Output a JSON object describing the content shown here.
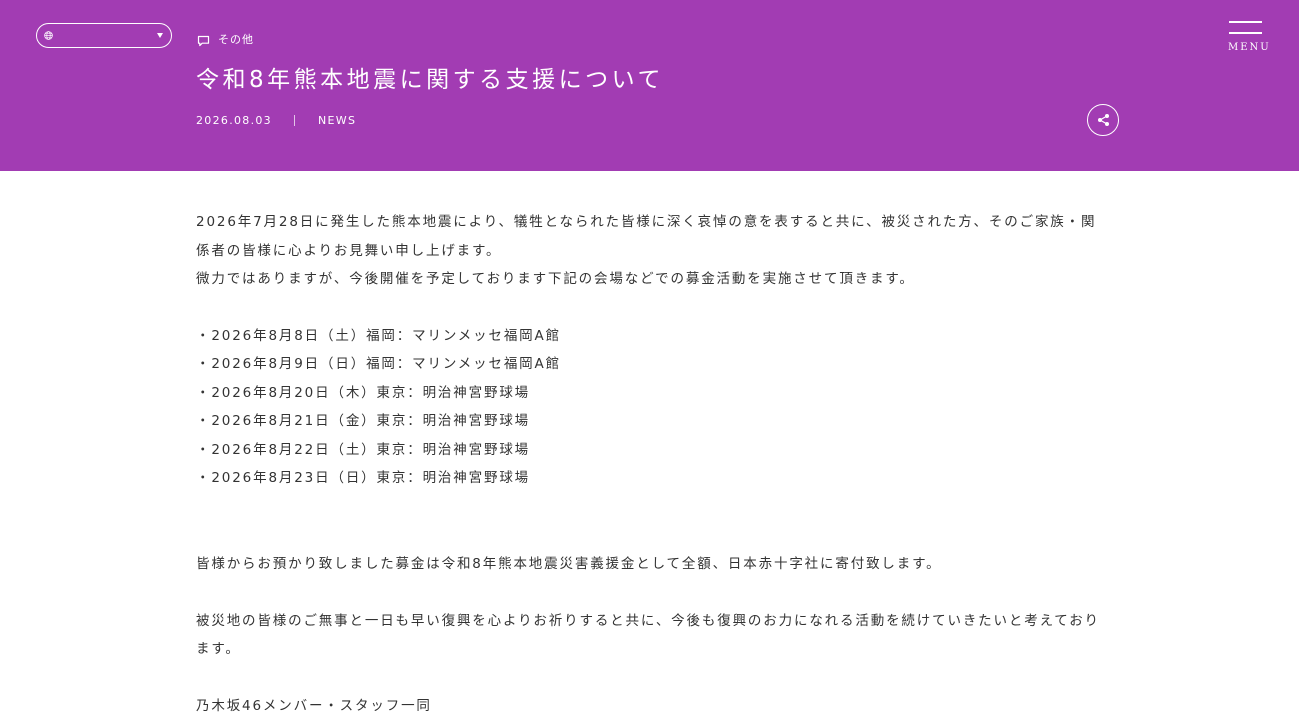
{
  "header": {
    "language_selector": {
      "value": "",
      "icon": "globe-icon"
    },
    "category": {
      "icon": "speech-bubble-icon",
      "label": "その他"
    },
    "title": "令和8年熊本地震に関する支援について",
    "date": "2026.08.03",
    "type": "NEWS",
    "menu_label": "MENU",
    "share_icon": "share-icon",
    "background_color": "#a23cb3"
  },
  "article": {
    "intro": "2026年7月28日に発生した熊本地震により、犠牲となられた皆様に深く哀悼の意を表すると共に、被災された方、そのご家族・関係者の皆様に心よりお見舞い申し上げます。",
    "intro_2": "微力ではありますが、今後開催を予定しております下記の会場などでの募金活動を実施させて頂きます。",
    "events": [
      "・2026年8月8日（土）福岡：マリンメッセ福岡A館",
      "・2026年8月9日（日）福岡：マリンメッセ福岡A館",
      "・2026年8月20日（木）東京：明治神宮野球場",
      "・2026年8月21日（金）東京：明治神宮野球場",
      "・2026年8月22日（土）東京：明治神宮野球場",
      "・2026年8月23日（日）東京：明治神宮野球場"
    ],
    "paragraph_1": "皆様からお預かり致しました募金は令和8年熊本地震災害義援金として全額、日本赤十字社に寄付致します。",
    "paragraph_2": "被災地の皆様のご無事と一日も早い復興を心よりお祈りすると共に、今後も復興のお力になれる活動を続けていきたいと考えております。",
    "signature": "乃木坂46メンバー・スタッフ一同"
  }
}
